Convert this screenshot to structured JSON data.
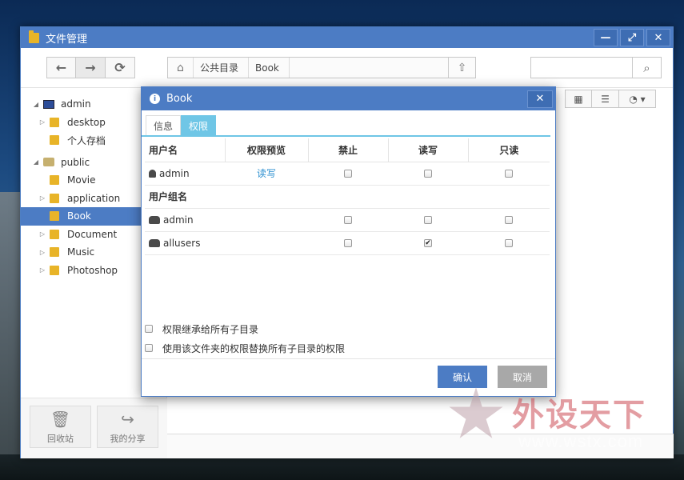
{
  "window": {
    "title": "文件管理",
    "controls": [
      "—",
      "⤢",
      "✕"
    ]
  },
  "toolbar": {
    "back_icon": "arrow-left-icon",
    "forward_icon": "arrow-right-icon",
    "refresh_icon": "refresh-icon",
    "breadcrumb": [
      "公共目录",
      "Book"
    ],
    "search_placeholder": ""
  },
  "sidebar": {
    "items": [
      {
        "label": "admin",
        "level": 0,
        "expanded": true,
        "type": "pc"
      },
      {
        "label": "desktop",
        "level": 1,
        "expandable": true,
        "type": "folder"
      },
      {
        "label": "个人存档",
        "level": 1,
        "expandable": false,
        "type": "folder"
      },
      {
        "label": "public",
        "level": 0,
        "expanded": true,
        "type": "network"
      },
      {
        "label": "Movie",
        "level": 1,
        "expandable": false,
        "type": "folder"
      },
      {
        "label": "application",
        "level": 1,
        "expandable": true,
        "type": "folder"
      },
      {
        "label": "Book",
        "level": 1,
        "expandable": false,
        "type": "folder",
        "selected": true
      },
      {
        "label": "Document",
        "level": 1,
        "expandable": true,
        "type": "folder"
      },
      {
        "label": "Music",
        "level": 1,
        "expandable": true,
        "type": "folder"
      },
      {
        "label": "Photoshop",
        "level": 1,
        "expandable": true,
        "type": "folder"
      }
    ],
    "recycle_label": "回收站",
    "share_label": "我的分享"
  },
  "dialog": {
    "title": "Book",
    "tabs": [
      "信息",
      "权限"
    ],
    "active_tab": "权限",
    "columns": [
      "用户名",
      "权限预览",
      "禁止",
      "读写",
      "只读"
    ],
    "users": [
      {
        "name": "admin",
        "preview": "读写",
        "deny": false,
        "readwrite": false,
        "readonly": false
      }
    ],
    "group_header": "用户组名",
    "groups": [
      {
        "name": "admin",
        "preview": "",
        "deny": false,
        "readwrite": false,
        "readonly": false
      },
      {
        "name": "allusers",
        "preview": "",
        "deny": false,
        "readwrite": true,
        "readonly": false
      }
    ],
    "options": [
      {
        "label": "权限继承给所有子目录",
        "checked": false
      },
      {
        "label": "使用该文件夹的权限替换所有子目录的权限",
        "checked": false
      }
    ],
    "ok_label": "确认",
    "cancel_label": "取消"
  },
  "watermark": {
    "brand": "外设天下",
    "url": "www.wstx.com"
  },
  "colors": {
    "accent": "#4c7cc4",
    "tab_active": "#6fc6e6",
    "link": "#2a8ecf",
    "cancel": "#a8a8a8"
  }
}
